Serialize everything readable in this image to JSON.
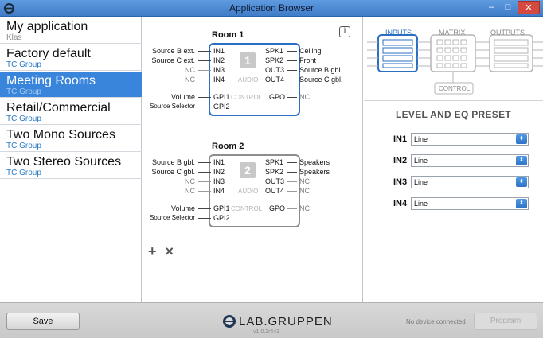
{
  "window": {
    "title": "Application Browser",
    "min": "–",
    "max": "□",
    "close": "✕"
  },
  "sidebar": {
    "items": [
      {
        "name": "My application",
        "group": "Klas"
      },
      {
        "name": "Factory default",
        "group": "TC Group"
      },
      {
        "name": "Meeting Rooms",
        "group": "TC Group",
        "selected": true
      },
      {
        "name": "Retail/Commercial",
        "group": "TC Group"
      },
      {
        "name": "Two Mono Sources",
        "group": "TC Group"
      },
      {
        "name": "Two Stereo Sources",
        "group": "TC Group"
      }
    ]
  },
  "rooms": [
    {
      "title": "Room 1",
      "number": "1",
      "inputs": [
        {
          "source": "Source B ext.",
          "port": "IN1"
        },
        {
          "source": "Source C ext.",
          "port": "IN2"
        },
        {
          "source": "NC",
          "port": "IN3"
        },
        {
          "source": "NC",
          "port": "IN4"
        }
      ],
      "outputs": [
        {
          "port": "SPK1",
          "dest": "Ceiling"
        },
        {
          "port": "SPK2",
          "dest": "Front"
        },
        {
          "port": "OUT3",
          "dest": "Source B gbl."
        },
        {
          "port": "OUT4",
          "dest": "Source C gbl."
        }
      ],
      "audio_label": "AUDIO",
      "control_label": "CONTROL",
      "gpi": [
        {
          "source": "Volume",
          "port": "GPI1"
        },
        {
          "source": "Source Selector",
          "port": "GPI2"
        }
      ],
      "gpo": {
        "port": "GPO",
        "dest": "NC"
      }
    },
    {
      "title": "Room 2",
      "number": "2",
      "inputs": [
        {
          "source": "Source B gbl.",
          "port": "IN1"
        },
        {
          "source": "Source C gbl.",
          "port": "IN2"
        },
        {
          "source": "NC",
          "port": "IN3"
        },
        {
          "source": "NC",
          "port": "IN4"
        }
      ],
      "outputs": [
        {
          "port": "SPK1",
          "dest": "Speakers"
        },
        {
          "port": "SPK2",
          "dest": "Speakers"
        },
        {
          "port": "OUT3",
          "dest": "NC"
        },
        {
          "port": "OUT4",
          "dest": "NC"
        }
      ],
      "audio_label": "AUDIO",
      "control_label": "CONTROL",
      "gpi": [
        {
          "source": "Volume",
          "port": "GPI1"
        },
        {
          "source": "Source Selector",
          "port": "GPI2"
        }
      ],
      "gpo": {
        "port": "GPO",
        "dest": "NC"
      }
    }
  ],
  "room_actions": {
    "add": "+",
    "remove": "×"
  },
  "info": "i",
  "tabs": {
    "inputs": "INPUTS",
    "matrix": "MATRIX",
    "outputs": "OUTPUTS",
    "control": "CONTROL"
  },
  "eq_panel": {
    "title": "LEVEL AND EQ PRESET",
    "rows": [
      {
        "label": "IN1",
        "value": "Line"
      },
      {
        "label": "IN2",
        "value": "Line"
      },
      {
        "label": "IN3",
        "value": "Line"
      },
      {
        "label": "IN4",
        "value": "Line"
      }
    ]
  },
  "footer": {
    "save": "Save",
    "logo": "LAB.GRUPPEN",
    "version": "v1.0.2r443",
    "status": "No device connected",
    "program": "Program"
  },
  "colors": {
    "accent": "#3a85dc",
    "room_active_border": "#2a6fc2",
    "close": "#d54a3e"
  }
}
